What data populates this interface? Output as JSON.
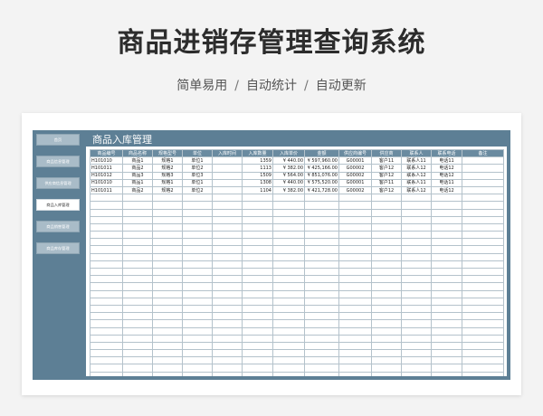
{
  "hero": {
    "title": "商品进销存管理查询系统",
    "subtitle": [
      "简单易用",
      "自动统计",
      "自动更新"
    ],
    "separator": "/"
  },
  "sidebar": {
    "items": [
      {
        "label": "首页"
      },
      {
        "label": "商品信息管理"
      },
      {
        "label": "供应商信息管理"
      },
      {
        "label": "商品入库管理"
      },
      {
        "label": "商品销售管理"
      },
      {
        "label": "商品库存管理"
      }
    ],
    "active_index": 3
  },
  "panel": {
    "title": "商品入库管理"
  },
  "table": {
    "columns": [
      "商品编号",
      "商品名称",
      "规格型号",
      "单位",
      "入库时间",
      "入库数量",
      "入库单价",
      "金额",
      "供应商编号",
      "供应商",
      "联系人",
      "联系电话",
      "备注"
    ],
    "rows": [
      [
        "H101010",
        "商品1",
        "规格1",
        "单位1",
        "",
        "1359",
        "¥ 440.00",
        "¥ 597,960.00",
        "G00001",
        "客户11",
        "联系人11",
        "电话11",
        ""
      ],
      [
        "H101011",
        "商品2",
        "规格2",
        "单位2",
        "",
        "1113",
        "¥ 382.00",
        "¥ 425,166.00",
        "G00002",
        "客户12",
        "联系人12",
        "电话12",
        ""
      ],
      [
        "H101012",
        "商品3",
        "规格3",
        "单位3",
        "",
        "1509",
        "¥ 564.00",
        "¥ 851,076.00",
        "G00002",
        "客户12",
        "联系人12",
        "电话12",
        ""
      ],
      [
        "H101010",
        "商品1",
        "规格1",
        "单位1",
        "",
        "1308",
        "¥ 440.00",
        "¥ 575,520.00",
        "G00001",
        "客户11",
        "联系人11",
        "电话11",
        ""
      ],
      [
        "H101011",
        "商品2",
        "规格2",
        "单位2",
        "",
        "1104",
        "¥ 382.00",
        "¥ 421,728.00",
        "G00002",
        "客户12",
        "联系人12",
        "电话12",
        ""
      ]
    ],
    "empty_rows": 25
  },
  "colors": {
    "app_background": "#5d7f95",
    "header_background": "#6a8ba0",
    "sidebar_button": "#a9bcc8",
    "grid_line": "#b4c2cb"
  }
}
